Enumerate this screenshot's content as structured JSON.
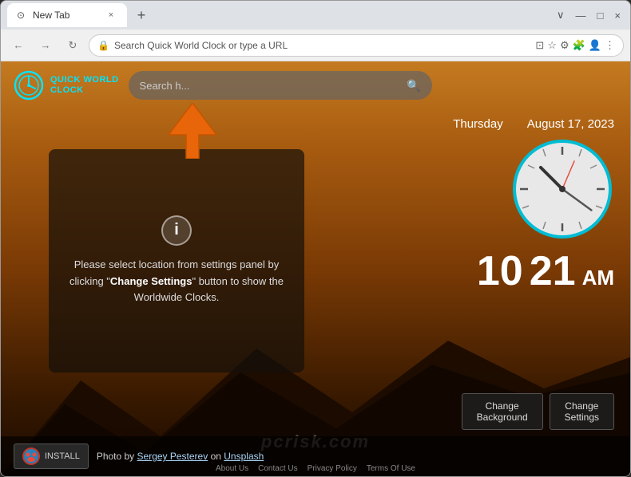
{
  "browser": {
    "tab_title": "New Tab",
    "tab_close": "×",
    "new_tab_btn": "+",
    "tab_bar_right": [
      "∨",
      "—",
      "□",
      "×"
    ],
    "address_bar_placeholder": "Search Quick World Clock or type a URL",
    "nav_back": "←",
    "nav_forward": "→",
    "nav_reload": "↻",
    "toolbar_icons": [
      "🔒",
      "★",
      "⚙",
      "🧩",
      "👤",
      "⋮"
    ]
  },
  "app": {
    "logo_text_line1": "QUICK WORLD",
    "logo_text_line2": "CLOCK",
    "search_placeholder": "Search h...",
    "day": "Thursday",
    "date": "August 17, 2023",
    "clock_hours": "10",
    "clock_minutes": "21",
    "clock_ampm": "AM",
    "info_message": "Please select location from settings panel by clicking \"Change Settings\" button to show the Worldwide Clocks.",
    "info_message_bold1": "Change",
    "info_message_bold2": "Settings",
    "change_bg_label": "Change\nBackground",
    "change_settings_label": "Change\nSettings",
    "photo_credit_prefix": "Photo by ",
    "photo_author": "Sergey Pesterev",
    "photo_on": " on ",
    "photo_platform": "Unsplash",
    "install_label": "INSTALL",
    "bottom_links": [
      "About Us",
      "Contact Us",
      "Privacy Policy",
      "Terms Of Use"
    ],
    "watermark": "pcrisk.com",
    "arrow": "▲"
  }
}
